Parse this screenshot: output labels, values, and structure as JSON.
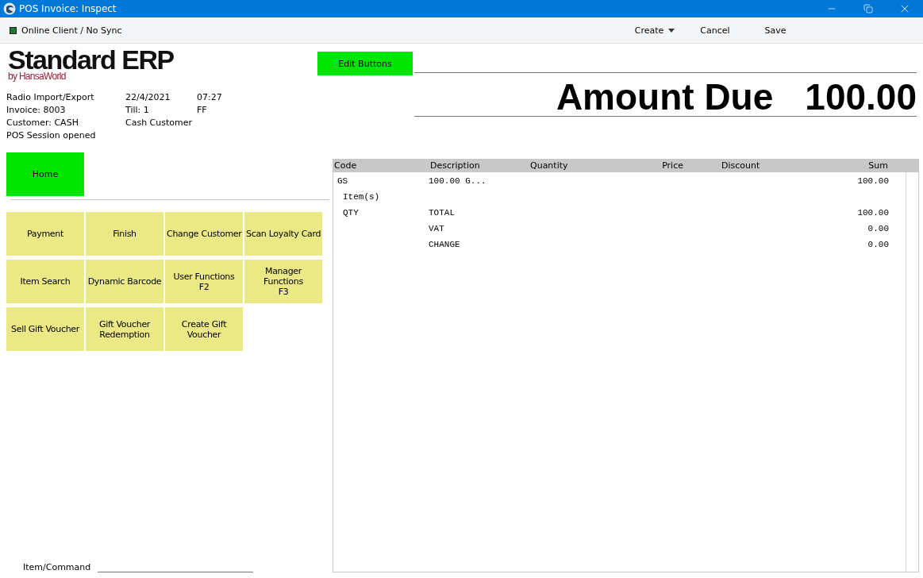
{
  "window": {
    "title": "POS Invoice: Inspect"
  },
  "toolbar": {
    "status": "Online Client / No Sync",
    "actions": [
      {
        "label": "Create",
        "kind": "menu"
      },
      {
        "label": "Cancel",
        "kind": "plain"
      },
      {
        "label": "Save",
        "kind": "plain"
      }
    ]
  },
  "logo": {
    "name": "Standard ERP",
    "byline": "by HansaWorld"
  },
  "info": [
    [
      "Radio Import/Export",
      "22/4/2021",
      "07:27"
    ],
    [
      "Invoice: 8003",
      "Till: 1",
      "FF"
    ],
    [
      "Customer: CASH",
      "Cash Customer"
    ],
    [
      "POS Session opened"
    ]
  ],
  "edit_button": "Edit Buttons",
  "amount": {
    "label": "Amount Due",
    "value": "100.00"
  },
  "home_button": "Home",
  "function_buttons": [
    [
      "Payment"
    ],
    [
      "Finish"
    ],
    [
      "Change Customer"
    ],
    [
      "Scan Loyalty Card"
    ],
    [
      "Item Search"
    ],
    [
      "Dynamic Barcode"
    ],
    [
      "User Functions",
      "F2"
    ],
    [
      "Manager",
      "Functions",
      "F3"
    ],
    [
      "Sell Gift Voucher"
    ],
    [
      "Gift Voucher",
      "Redemption"
    ],
    [
      "Create Gift",
      "Voucher"
    ]
  ],
  "command": {
    "label": "Item/Command"
  },
  "table": {
    "columns": [
      "Code",
      "Description",
      "Quantity",
      "Price",
      "Discount",
      "Sum"
    ],
    "rows": [
      {
        "kind": "line",
        "code": "GS",
        "description": "100.00 G...",
        "sum": "100.00"
      },
      {
        "kind": "note",
        "text": "Item(s)"
      },
      {
        "kind": "line",
        "code": "QTY",
        "description": "TOTAL",
        "sum": "100.00"
      },
      {
        "kind": "line",
        "description": "VAT",
        "sum": "0.00"
      },
      {
        "kind": "line",
        "description": "CHANGE",
        "sum": "0.00"
      }
    ]
  }
}
